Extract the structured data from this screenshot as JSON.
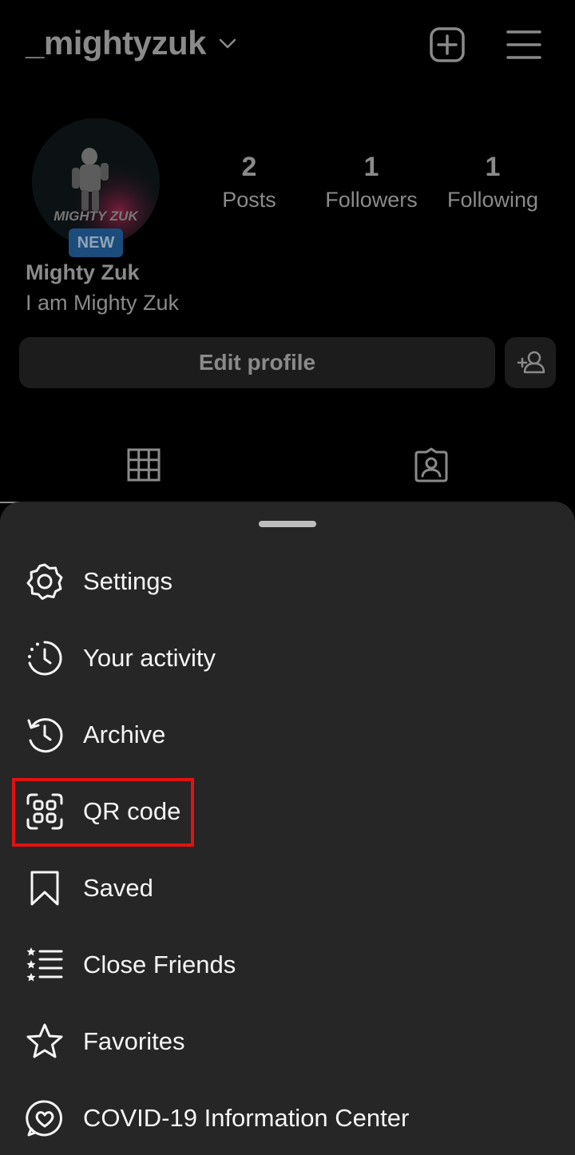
{
  "profile": {
    "username": "_mightyzuk",
    "avatar_text": "MIGHTY ZUK",
    "badge": "NEW",
    "stats": [
      {
        "value": "2",
        "label": "Posts"
      },
      {
        "value": "1",
        "label": "Followers"
      },
      {
        "value": "1",
        "label": "Following"
      }
    ],
    "display_name": "Mighty Zuk",
    "bio": "I am Mighty Zuk",
    "edit_button": "Edit profile"
  },
  "icons": {
    "header": [
      "chevron-down-icon",
      "plus-square-icon",
      "hamburger-menu-icon"
    ],
    "tabs": [
      "grid-icon",
      "tagged-person-icon"
    ]
  },
  "menu": {
    "items": [
      {
        "label": "Settings",
        "icon": "settings-icon"
      },
      {
        "label": "Your activity",
        "icon": "activity-icon"
      },
      {
        "label": "Archive",
        "icon": "archive-icon"
      },
      {
        "label": "QR code",
        "icon": "qr-code-icon",
        "highlighted": true
      },
      {
        "label": "Saved",
        "icon": "bookmark-icon"
      },
      {
        "label": "Close Friends",
        "icon": "close-friends-icon"
      },
      {
        "label": "Favorites",
        "icon": "star-icon"
      },
      {
        "label": "COVID-19 Information Center",
        "icon": "heart-chat-icon"
      }
    ]
  },
  "colors": {
    "background": "#000000",
    "sheet": "#262626",
    "highlight": "#e11212",
    "badge": "#1b4c7c"
  }
}
